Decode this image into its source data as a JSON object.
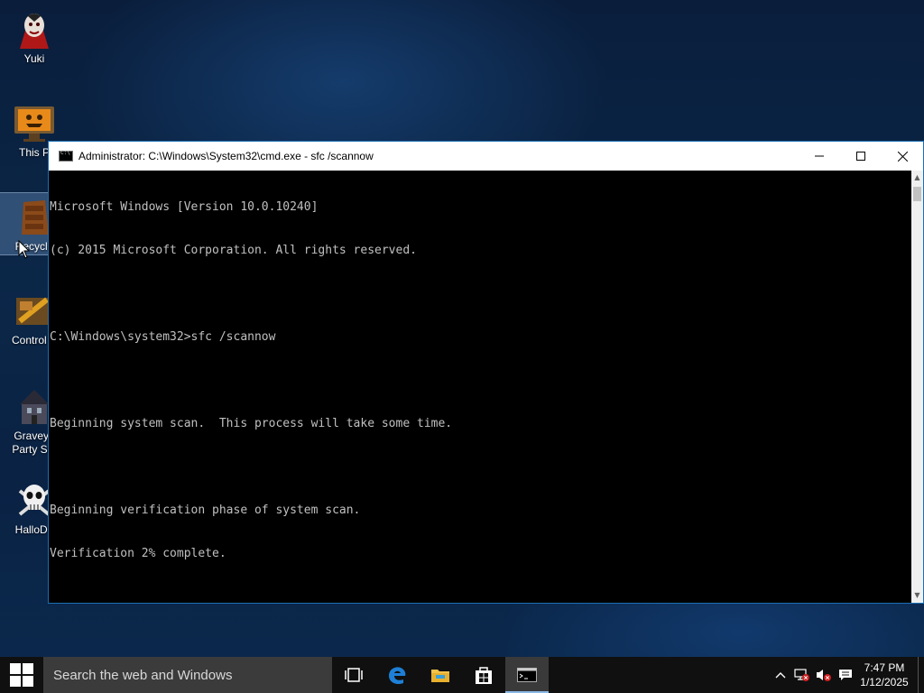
{
  "desktop": {
    "icons": [
      {
        "label": "Yuki"
      },
      {
        "label": "This P"
      },
      {
        "label": "Recycle"
      },
      {
        "label": "Control P"
      },
      {
        "label": "Graveya\nParty Scr"
      },
      {
        "label": "HalloDo"
      }
    ]
  },
  "window": {
    "title": "Administrator: C:\\Windows\\System32\\cmd.exe - sfc  /scannow",
    "buttons": {
      "minimize": "—",
      "maximize": "☐",
      "close": "✕"
    },
    "console_lines": [
      "Microsoft Windows [Version 10.0.10240]",
      "(c) 2015 Microsoft Corporation. All rights reserved.",
      "",
      "C:\\Windows\\system32>sfc /scannow",
      "",
      "Beginning system scan.  This process will take some time.",
      "",
      "Beginning verification phase of system scan.",
      "Verification 2% complete."
    ]
  },
  "taskbar": {
    "search_placeholder": "Search the web and Windows",
    "pinned": [
      {
        "icon": "task-view-icon"
      },
      {
        "icon": "edge-icon"
      },
      {
        "icon": "file-explorer-icon"
      },
      {
        "icon": "store-icon"
      },
      {
        "icon": "command-prompt-icon",
        "active": true
      }
    ],
    "tray": {
      "time": "7:47 PM",
      "date": "1/12/2025"
    }
  },
  "colors": {
    "taskbar_bg": "#101010",
    "search_bg": "#3b3b3b",
    "console_text": "#c0c0c0",
    "window_border": "#1b6fb3",
    "edge_blue": "#1e7fd6"
  }
}
